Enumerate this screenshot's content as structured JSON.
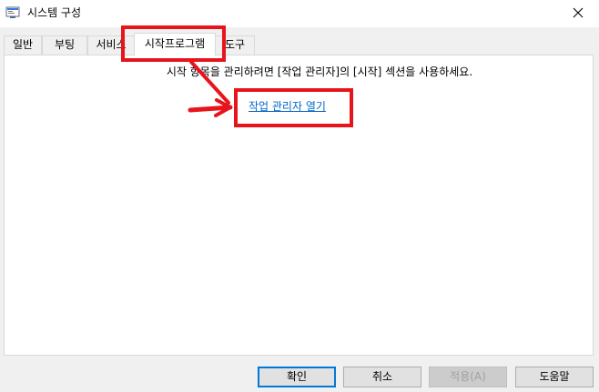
{
  "window": {
    "title": "시스템 구성",
    "app_icon": "system-config-icon",
    "close_icon": "close-icon"
  },
  "tabs": [
    {
      "label": "일반",
      "active": false
    },
    {
      "label": "부팅",
      "active": false
    },
    {
      "label": "서비스",
      "active": false
    },
    {
      "label": "시작프로그램",
      "active": true
    },
    {
      "label": "도구",
      "active": false
    }
  ],
  "startup_panel": {
    "info_text": "시작 항목을 관리하려면 [작업 관리자]의 [시작] 섹션을 사용하세요.",
    "task_manager_link": "작업 관리자 열기"
  },
  "buttons": {
    "ok": "확인",
    "cancel": "취소",
    "apply": "적용(A)",
    "help": "도움말"
  },
  "annotation_color": "#e8141c",
  "link_color": "#0066cc",
  "focus_color": "#0078d7"
}
